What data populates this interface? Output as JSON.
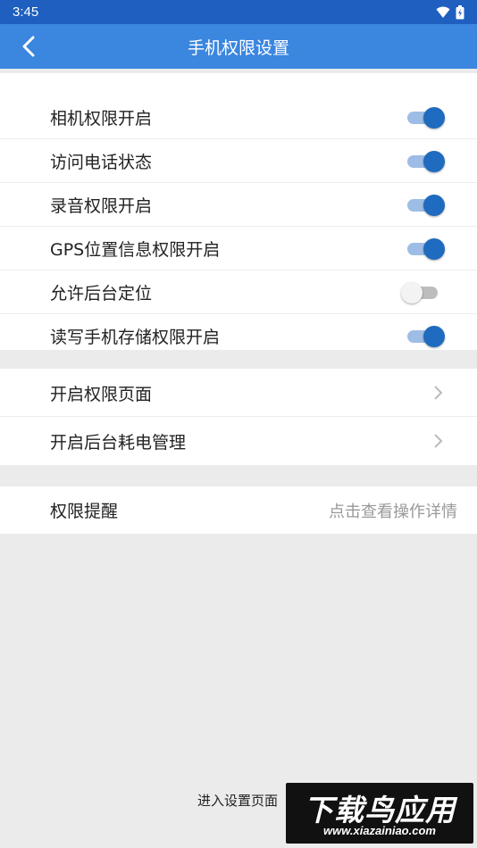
{
  "status_bar": {
    "time": "3:45"
  },
  "app_bar": {
    "title": "手机权限设置"
  },
  "permissions": [
    {
      "label": "相机权限开启",
      "enabled": true
    },
    {
      "label": "访问电话状态",
      "enabled": true
    },
    {
      "label": "录音权限开启",
      "enabled": true
    },
    {
      "label": "GPS位置信息权限开启",
      "enabled": true
    },
    {
      "label": "允许后台定位",
      "enabled": false
    },
    {
      "label": "读写手机存储权限开启",
      "enabled": true
    }
  ],
  "nav_items": [
    {
      "label": "开启权限页面"
    },
    {
      "label": "开启后台耗电管理"
    }
  ],
  "reminder": {
    "label": "权限提醒",
    "hint": "点击查看操作详情"
  },
  "footer": {
    "link": "进入设置页面"
  },
  "watermark": {
    "main": "下载鸟应用",
    "sub": "www.xiazainiao.com"
  },
  "colors": {
    "status_bar": "#1e5fbf",
    "app_bar": "#3b86df",
    "toggle_on_thumb": "#1f6bbf",
    "toggle_on_track": "#9ebde6",
    "toggle_off_track": "#bdbdbd",
    "background": "#ebebeb"
  }
}
